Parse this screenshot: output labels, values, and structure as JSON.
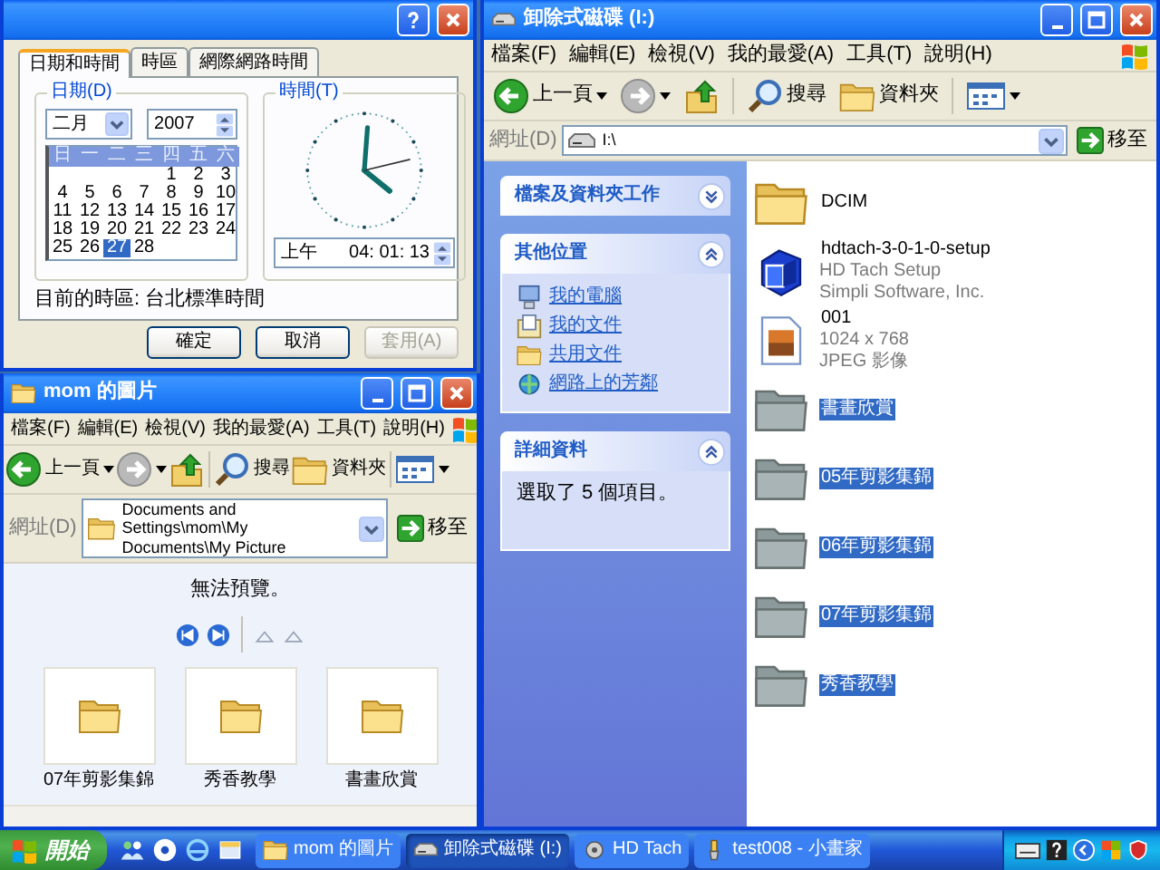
{
  "date_time_dialog": {
    "tabs": [
      {
        "label": "日期和時間",
        "selected": true
      },
      {
        "label": "時區",
        "selected": false
      },
      {
        "label": "網際網路時間",
        "selected": false
      }
    ],
    "date": {
      "title": "日期(D)",
      "month": "二月",
      "year": "2007",
      "weekdays": [
        "日",
        "一",
        "二",
        "三",
        "四",
        "五",
        "六"
      ],
      "weeks": [
        [
          {
            "day": "1",
            "selected": false
          },
          {
            "day": "2",
            "selected": false
          },
          {
            "day": "3",
            "selected": false
          }
        ],
        [
          {
            "day": "4",
            "selected": false
          },
          {
            "day": "5",
            "selected": false
          },
          {
            "day": "6",
            "selected": false
          },
          {
            "day": "7",
            "selected": false
          },
          {
            "day": "8",
            "selected": false
          },
          {
            "day": "9",
            "selected": false
          },
          {
            "day": "10",
            "selected": false
          }
        ],
        [
          {
            "day": "11",
            "selected": false
          },
          {
            "day": "12",
            "selected": false
          },
          {
            "day": "13",
            "selected": false
          },
          {
            "day": "14",
            "selected": false
          },
          {
            "day": "15",
            "selected": false
          },
          {
            "day": "16",
            "selected": false
          },
          {
            "day": "17",
            "selected": false
          }
        ],
        [
          {
            "day": "18",
            "selected": false
          },
          {
            "day": "19",
            "selected": false
          },
          {
            "day": "20",
            "selected": false
          },
          {
            "day": "21",
            "selected": false
          },
          {
            "day": "22",
            "selected": false
          },
          {
            "day": "23",
            "selected": false
          },
          {
            "day": "24",
            "selected": false
          }
        ],
        [
          {
            "day": "25",
            "selected": false
          },
          {
            "day": "26",
            "selected": false
          },
          {
            "day": "27",
            "selected": true
          },
          {
            "day": "28",
            "selected": false
          }
        ]
      ]
    },
    "time": {
      "title": "時間(T)",
      "period": "上午",
      "value": "04: 01: 13"
    },
    "time_zone": "目前的時區: 台北標準時間",
    "buttons": [
      {
        "label": "確定",
        "disabled": false
      },
      {
        "label": "取消",
        "disabled": false
      },
      {
        "label": "套用(A)",
        "disabled": true
      }
    ]
  },
  "pictures_window": {
    "title": "mom 的圖片",
    "menu": [
      "檔案(F)",
      "編輯(E)",
      "檢視(V)",
      "我的最愛(A)",
      "工具(T)",
      "說明(H)"
    ],
    "toolbar": {
      "back": "上一頁",
      "search": "搜尋",
      "folders": "資料夾"
    },
    "address": {
      "label": "網址(D)",
      "value": "Documents and Settings\\mom\\My Documents\\My Picture",
      "go": "移至"
    },
    "preview_message": "無法預覽。",
    "filmstrip": [
      {
        "name": "07年剪影集錦"
      },
      {
        "name": "秀香教學"
      },
      {
        "name": "書畫欣賞"
      }
    ]
  },
  "drive_window": {
    "title": "卸除式磁碟 (I:)",
    "menu": [
      "檔案(F)",
      "編輯(E)",
      "檢視(V)",
      "我的最愛(A)",
      "工具(T)",
      "說明(H)"
    ],
    "toolbar": {
      "back": "上一頁",
      "search": "搜尋",
      "folders": "資料夾"
    },
    "address": {
      "label": "網址(D)",
      "value": "I:\\",
      "go": "移至"
    },
    "task_panels": [
      {
        "kind": "tasks",
        "title": "檔案及資料夾工作",
        "expanded": false
      },
      {
        "kind": "links",
        "title": "其他位置",
        "expanded": true,
        "links": [
          {
            "kind": "computer",
            "label": "我的電腦"
          },
          {
            "kind": "documents",
            "label": "我的文件"
          },
          {
            "kind": "folder",
            "label": "共用文件"
          },
          {
            "kind": "network",
            "label": "網路上的芳鄰"
          }
        ]
      },
      {
        "kind": "details",
        "title": "詳細資料",
        "expanded": true,
        "text": "選取了 5 個項目。"
      }
    ],
    "files": [
      {
        "kind": "folder",
        "name": "DCIM",
        "selected": false
      },
      {
        "kind": "installer",
        "name": "hdtach-3-0-1-0-setup",
        "details": [
          "HD Tach Setup",
          "Simpli Software, Inc."
        ],
        "selected": false
      },
      {
        "kind": "image",
        "name": "001",
        "details": [
          "1024 x 768",
          "JPEG 影像"
        ],
        "selected": false
      },
      {
        "kind": "folder",
        "name": "書畫欣賞",
        "selected": true
      },
      {
        "kind": "folder",
        "name": "05年剪影集錦",
        "selected": true
      },
      {
        "kind": "folder",
        "name": "06年剪影集錦",
        "selected": true
      },
      {
        "kind": "folder",
        "name": "07年剪影集錦",
        "selected": true
      },
      {
        "kind": "folder",
        "name": "秀香教學",
        "selected": true
      }
    ]
  },
  "taskbar": {
    "start": "開始",
    "tasks": [
      {
        "kind": "folder",
        "label": "mom 的圖片",
        "selected": false
      },
      {
        "kind": "drive",
        "label": "卸除式磁碟 (I:)",
        "selected": true
      },
      {
        "kind": "disk",
        "label": "HD Tach",
        "selected": false
      },
      {
        "kind": "paint",
        "label": "test008 - 小畫家",
        "selected": false
      }
    ]
  }
}
